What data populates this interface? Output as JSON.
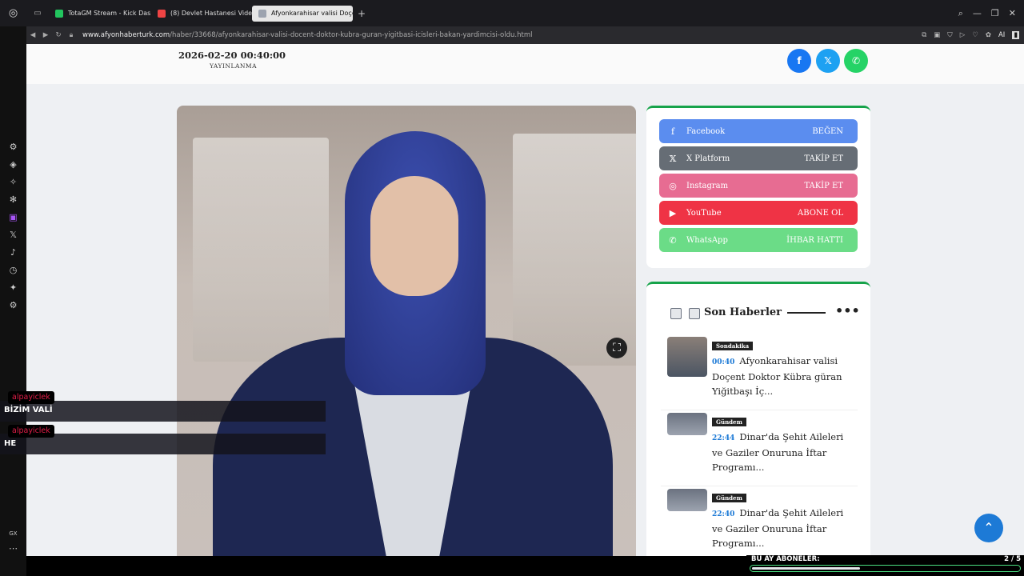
{
  "browser": {
    "tabs": [
      {
        "label": "TotaGM Stream - Kick Das",
        "color": "#22c55e"
      },
      {
        "label": "(8) Devlet Hastanesi Vide",
        "color": "#ef4444"
      },
      {
        "label": "Afyonkarahisar valisi Doçe",
        "color": "#9ca3af"
      }
    ],
    "new_tab": "+",
    "url_domain": "www.afyonhaberturk.com",
    "url_path": "/haber/33668/afyonkarahisar-valisi-docent-doktor-kubra-guran-yigitbasi-icisleri-bakan-yardimcisi-oldu.html",
    "ai_label": "AI"
  },
  "article": {
    "date": "2026-02-20 00:40:00",
    "date_label": "YAYINLANMA"
  },
  "share": [
    {
      "icon": "facebook-icon",
      "glyph": "f",
      "color": "#1877f2"
    },
    {
      "icon": "x-icon",
      "glyph": "𝕏",
      "color": "#1da1f2"
    },
    {
      "icon": "whatsapp-icon",
      "glyph": "✆",
      "color": "#25d366"
    }
  ],
  "social": [
    {
      "name": "Facebook",
      "action": "BEĞEN",
      "glyph": "f",
      "color": "#5b8def"
    },
    {
      "name": "X Platform",
      "action": "TAKİP ET",
      "glyph": "𝕏",
      "color": "#666d75"
    },
    {
      "name": "Instagram",
      "action": "TAKİP ET",
      "glyph": "◎",
      "color": "#e76c92"
    },
    {
      "name": "YouTube",
      "action": "ABONE OL",
      "glyph": "▶",
      "color": "#ef3345"
    },
    {
      "name": "WhatsApp",
      "action": "İHBAR HATTI",
      "glyph": "✆",
      "color": "#6bdc87"
    }
  ],
  "son_haberler": {
    "title": "Son Haberler",
    "items": [
      {
        "category": "Sondakika",
        "time": "00:40",
        "text": "Afyonkarahisar valisi Doçent Doktor Kübra güran Yiğitbaşı İç..."
      },
      {
        "category": "Gündem",
        "time": "22:44",
        "text": "Dinar'da Şehit Aileleri ve Gaziler Onuruna İftar Programı..."
      },
      {
        "category": "Gündem",
        "time": "22:40",
        "text": "Dinar'da Şehit Aileleri ve Gaziler Onuruna İftar Programı..."
      }
    ]
  },
  "chat": [
    {
      "user": "alpayiclek",
      "message": "BİZİM VALİ"
    },
    {
      "user": "alpayiclek",
      "message": "HE"
    }
  ],
  "subscribers": {
    "label": "BU AY ABONELER:",
    "count": "2 / 5",
    "progress": 0.4
  },
  "left_rail_bottom": "GX"
}
